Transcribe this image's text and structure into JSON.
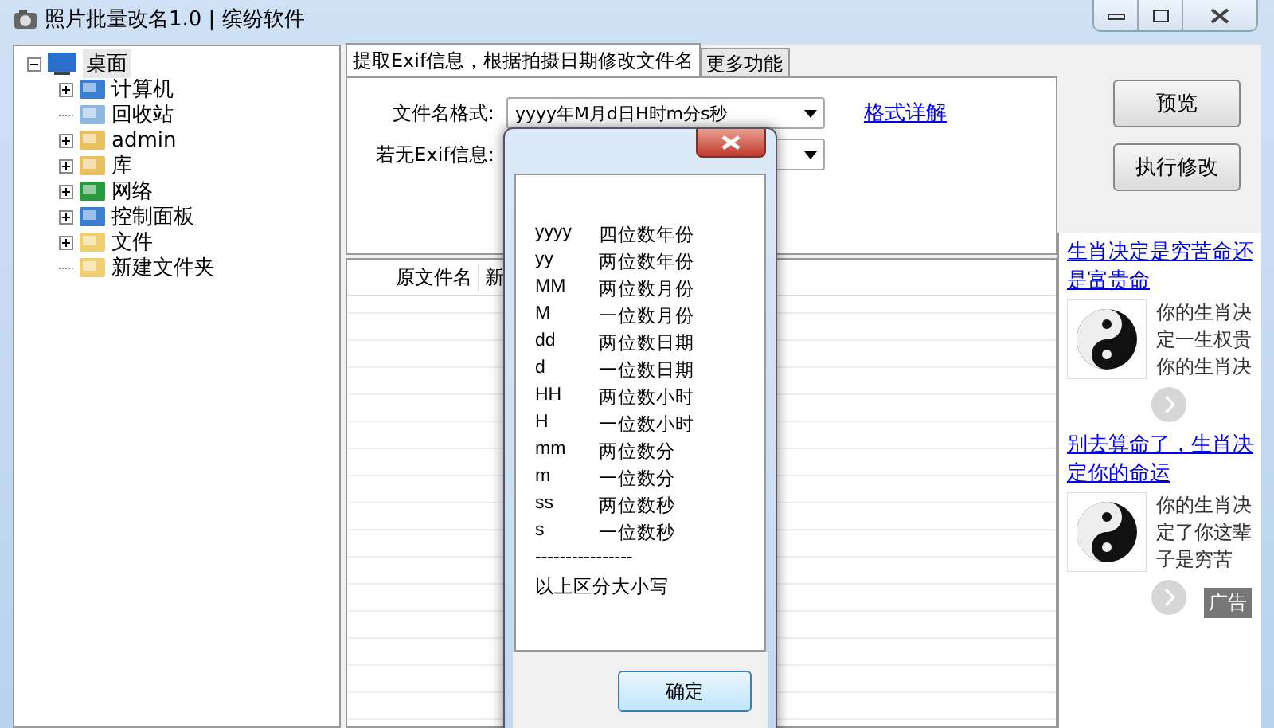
{
  "window": {
    "title": "照片批量改名1.0 | 缤纷软件"
  },
  "tree": {
    "label": "桌面",
    "selected": true,
    "expanded": true,
    "children": [
      {
        "label": "计算机",
        "expandable": true,
        "selected": false
      },
      {
        "label": "回收站",
        "expandable": false,
        "selected": false
      },
      {
        "label": "admin",
        "expandable": true,
        "selected": false
      },
      {
        "label": "库",
        "expandable": true,
        "selected": false
      },
      {
        "label": "网络",
        "expandable": true,
        "selected": false
      },
      {
        "label": "控制面板",
        "expandable": true,
        "selected": false
      },
      {
        "label": "文件",
        "expandable": true,
        "selected": false
      },
      {
        "label": "新建文件夹",
        "expandable": false,
        "selected": false
      }
    ]
  },
  "tabs": [
    {
      "label": "提取Exif信息，根据拍摄日期修改文件名",
      "selected": true
    },
    {
      "label": "更多功能",
      "selected": false
    }
  ],
  "form": {
    "format_label": "文件名格式:",
    "format_value": "yyyy年M月d日H时m分s秒",
    "format_link": "格式详解",
    "noexif_label": "若无Exif信息:"
  },
  "buttons": [
    "预览",
    "执行修改"
  ],
  "table": {
    "columns": [
      "原文件名",
      "新"
    ]
  },
  "ads": [
    {
      "title": "生肖决定是穷苦命还是富贵命",
      "lines": [
        "你的生肖决",
        "定一生权贵",
        "你的生肖决"
      ]
    },
    {
      "title": "别去算命了，生肖决定你的命运",
      "lines": [
        "你的生肖决",
        "定了你这辈",
        "子是穷苦"
      ]
    }
  ],
  "ad_label": "广告",
  "dialog": {
    "rows": [
      {
        "code": "yyyy",
        "desc": "四位数年份"
      },
      {
        "code": "yy",
        "desc": "两位数年份"
      },
      {
        "code": "MM",
        "desc": "两位数月份"
      },
      {
        "code": "M",
        "desc": "一位数月份"
      },
      {
        "code": "dd",
        "desc": "两位数日期"
      },
      {
        "code": "d",
        "desc": "一位数日期"
      },
      {
        "code": "HH",
        "desc": "两位数小时"
      },
      {
        "code": "H",
        "desc": "一位数小时"
      },
      {
        "code": "mm",
        "desc": "两位数分"
      },
      {
        "code": "m",
        "desc": "一位数分"
      },
      {
        "code": "ss",
        "desc": "两位数秒"
      },
      {
        "code": "s",
        "desc": "一位数秒"
      }
    ],
    "separator": "----------------",
    "note": "以上区分大小写",
    "ok": "确定"
  }
}
